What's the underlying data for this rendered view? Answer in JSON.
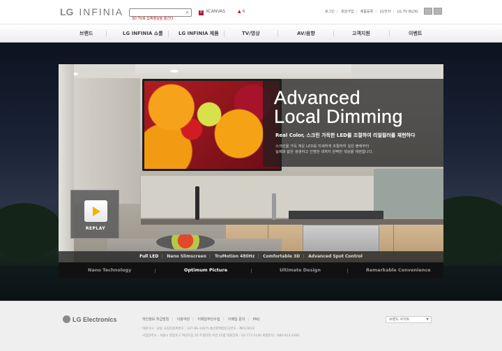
{
  "header": {
    "logo_brand": "LG",
    "logo_product": "INFINIA",
    "search_value": "3D TV로 입체영상을 즐긴다",
    "xcanvas": {
      "mark": "X",
      "label": "XCANVAS"
    },
    "badge_count": "6",
    "top_links": [
      "로그인",
      "회원가입",
      "제품등록",
      "LG전자",
      "LG TV BLOG"
    ]
  },
  "nav": {
    "items": [
      "브랜드",
      "LG INFINIA 쇼룸",
      "LG INFINIA 제품",
      "TV/영상",
      "AV/음향",
      "고객지원",
      "이벤트"
    ]
  },
  "hero": {
    "headline_line1": "Advanced",
    "headline_line2": "Local Dimming",
    "subhead": "Real Color, 스크린 가득한 LED를 조절하여 리얼컬러를 재현하다",
    "desc_line1": "스크린을 가득 채운 LED를 미세하게 조절하여 깊은 블랙부터",
    "desc_line2": "실제와 같은 생생하고 선명한 색까지 완벽한 색상을 재현합니다.",
    "close_label": "×",
    "replay_label": "REPLAY",
    "features": [
      "Full LED",
      "Nano Slimscreen",
      "TruMotion 480Hz",
      "Comfortable 3D",
      "Advanced Spot Control"
    ],
    "tabs": [
      "Nano Technology",
      "Optimum Picture",
      "Ultimate Design",
      "Remarkable Convenience"
    ]
  },
  "footer": {
    "logo": "LG Electronics",
    "links": [
      "개인정보 취급방침",
      "이용약관",
      "이메일무단수집",
      "이메일 문의",
      "FAQ"
    ],
    "info_line1": "대표이사 : 남용    사업자등록번호 : 107-86-14075    통신판매업신고번호 : 제01765호",
    "info_line2": "사업장주소 : 서울시 영등포구 여의도동 20 트윈타워 서관 25층    대표전화 : 02-777-1144    회원문의 : 080-023-3300",
    "site_select": "브랜드 사이트"
  }
}
